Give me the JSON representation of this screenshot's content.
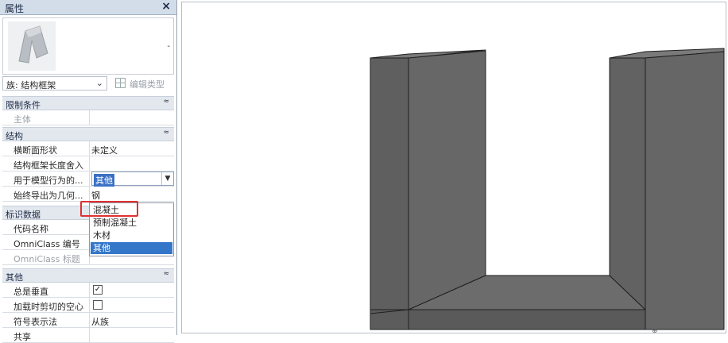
{
  "panel": {
    "title": "属性",
    "close_glyph": "×",
    "preview_dropdown_glyph": "-",
    "type_selector": {
      "value": "族: 结构框架",
      "chevron": "⌄"
    },
    "edit_type_label": "编辑类型",
    "sections": {
      "constraints": {
        "label": "限制条件",
        "toggle": "≈"
      },
      "structure": {
        "label": "结构",
        "toggle": "≈"
      },
      "identity": {
        "label": "标识数据"
      },
      "other": {
        "label": "其他",
        "toggle": "≈"
      }
    },
    "rows": {
      "host": {
        "key": "主体",
        "value": ""
      },
      "cross_section": {
        "key": "横断面形状",
        "value": "未定义"
      },
      "frame_length_round": {
        "key": "结构框架长度舍入",
        "value": ""
      },
      "model_behavior_material": {
        "key": "用于模型行为的...",
        "value": "其他"
      },
      "analytic_geometry": {
        "key": "始终导出为几何...",
        "value": "钢"
      },
      "code_name": {
        "key": "代码名称",
        "value": ""
      },
      "omniclass_number": {
        "key": "OmniClass 编号",
        "value": ""
      },
      "omniclass_title": {
        "key": "OmniClass 标题",
        "value": ""
      },
      "always_vertical": {
        "key": "总是垂直",
        "checked": true
      },
      "cut_voids": {
        "key": "加载时剪切的空心",
        "checked": false
      },
      "symbol_method": {
        "key": "符号表示法",
        "value": "从族"
      },
      "partial": {
        "key": "共享",
        "value": ""
      }
    },
    "material_dropdown": {
      "options": [
        "混凝土",
        "预制混凝土",
        "木材",
        "其他"
      ],
      "highlighted_index": 3
    }
  },
  "viewport": {
    "shape_colors": {
      "front": "#5c5c5c",
      "side": "#6f6f6f",
      "top": "#7a7a7a",
      "floor": "#636363",
      "edge": "#1f1f1f"
    }
  },
  "watermark": "⊕"
}
